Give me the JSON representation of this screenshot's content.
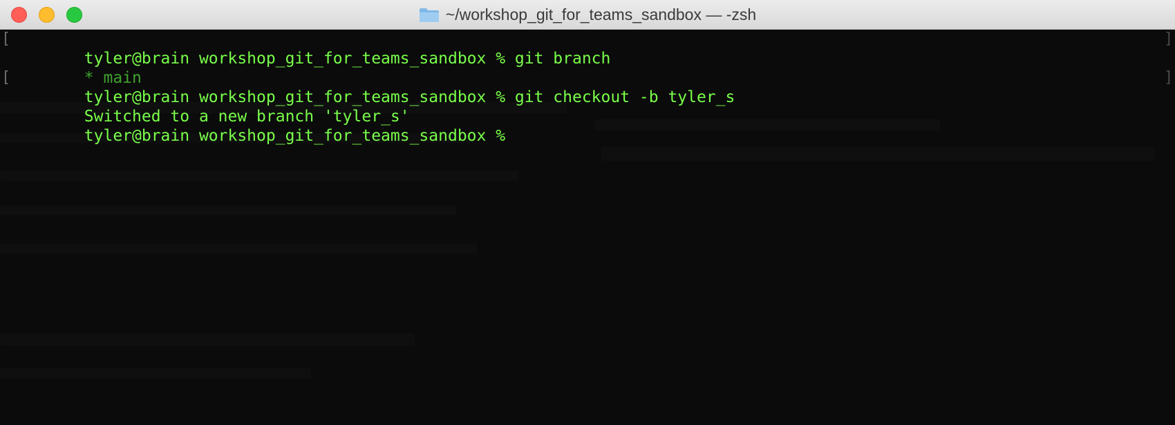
{
  "window": {
    "title": "~/workshop_git_for_teams_sandbox — -zsh",
    "folder_icon": "folder-icon"
  },
  "terminal": {
    "text_color": "#79ff4a",
    "background": "#0b0b0b",
    "lines": [
      {
        "text": "tyler@brain workshop_git_for_teams_sandbox % git branch",
        "marked": true
      },
      {
        "text": "* main",
        "marked": false
      },
      {
        "text": "tyler@brain workshop_git_for_teams_sandbox % git checkout -b tyler_s",
        "marked": true
      },
      {
        "text": "Switched to a new branch 'tyler_s'",
        "marked": false
      },
      {
        "text": "tyler@brain workshop_git_for_teams_sandbox %",
        "marked": false
      }
    ]
  }
}
